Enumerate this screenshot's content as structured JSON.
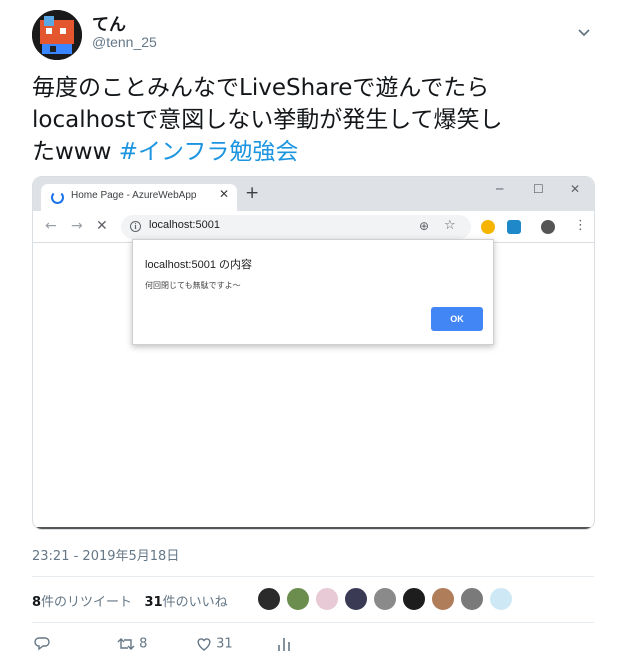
{
  "author": {
    "display_name": "てん",
    "handle": "@tenn_25",
    "avatar_icon": "pixel-art-avatar",
    "more_icon": "chevron-down-icon"
  },
  "tweet": {
    "text_line1": "毎度のことみんなでLiveShareで遊んでたら",
    "text_line2": "localhostで意図しない挙動が発生して爆笑し",
    "text_line3_prefix": "たwww ",
    "hashtag": "#インフラ勉強会",
    "hashtag_color": "#1b95e0"
  },
  "browser": {
    "tab_title": "Home Page - AzureWebApp",
    "tab_close": "✕",
    "new_tab": "+",
    "win_minimize": "─",
    "win_maximize": "☐",
    "win_close": "✕",
    "back": "←",
    "forward": "→",
    "stop": "✕",
    "info": "i",
    "url": "localhost:5001",
    "zoom": "⊕",
    "star": "☆",
    "menu": "⋮",
    "dialog": {
      "title": "localhost:5001 の内容",
      "message": "何回閉じても無駄ですよ〜",
      "ok_label": "OK"
    }
  },
  "meta": {
    "timestamp": "23:21 - 2019年5月18日",
    "retweet_count": "8",
    "retweet_label": "件のリツイート",
    "like_count": "31",
    "like_label": "件のいいね"
  },
  "actions": {
    "reply_icon": "reply-icon",
    "retweet_icon": "retweet-icon",
    "retweet_count": "8",
    "like_icon": "heart-icon",
    "like_count": "31",
    "analytics_icon": "analytics-icon"
  },
  "likers": [
    "liker-1",
    "liker-2",
    "liker-3",
    "liker-4",
    "liker-5",
    "liker-6",
    "liker-7",
    "liker-8",
    "liker-9"
  ]
}
